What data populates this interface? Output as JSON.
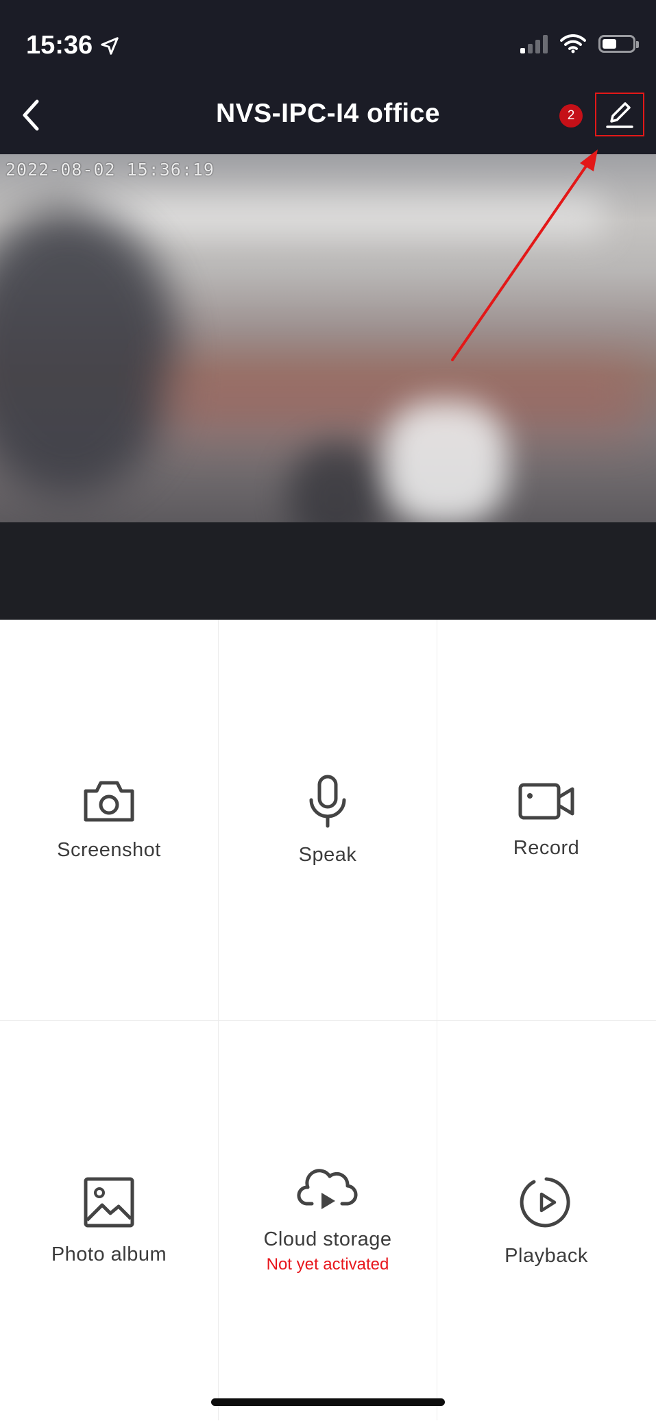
{
  "status_bar": {
    "time": "15:36",
    "icons": [
      "location-arrow-icon",
      "signal-icon",
      "wifi-icon",
      "battery-icon"
    ]
  },
  "nav": {
    "title": "NVS-IPC-I4 office",
    "badge_count": "2",
    "back_icon": "chevron-left-icon",
    "edit_icon": "pencil-icon"
  },
  "video": {
    "timestamp_overlay": "2022-08-02 15:36:19"
  },
  "actions": [
    {
      "label": "Screenshot",
      "icon": "camera-icon"
    },
    {
      "label": "Speak",
      "icon": "microphone-icon"
    },
    {
      "label": "Record",
      "icon": "video-camera-icon"
    },
    {
      "label": "Photo album",
      "icon": "image-icon"
    },
    {
      "label": "Cloud storage",
      "sublabel": "Not yet activated",
      "icon": "cloud-play-icon"
    },
    {
      "label": "Playback",
      "icon": "playback-icon"
    }
  ],
  "colors": {
    "header_bg": "#1b1c26",
    "badge": "#c51018",
    "highlight": "#e31818",
    "warning_text": "#e8161c"
  }
}
